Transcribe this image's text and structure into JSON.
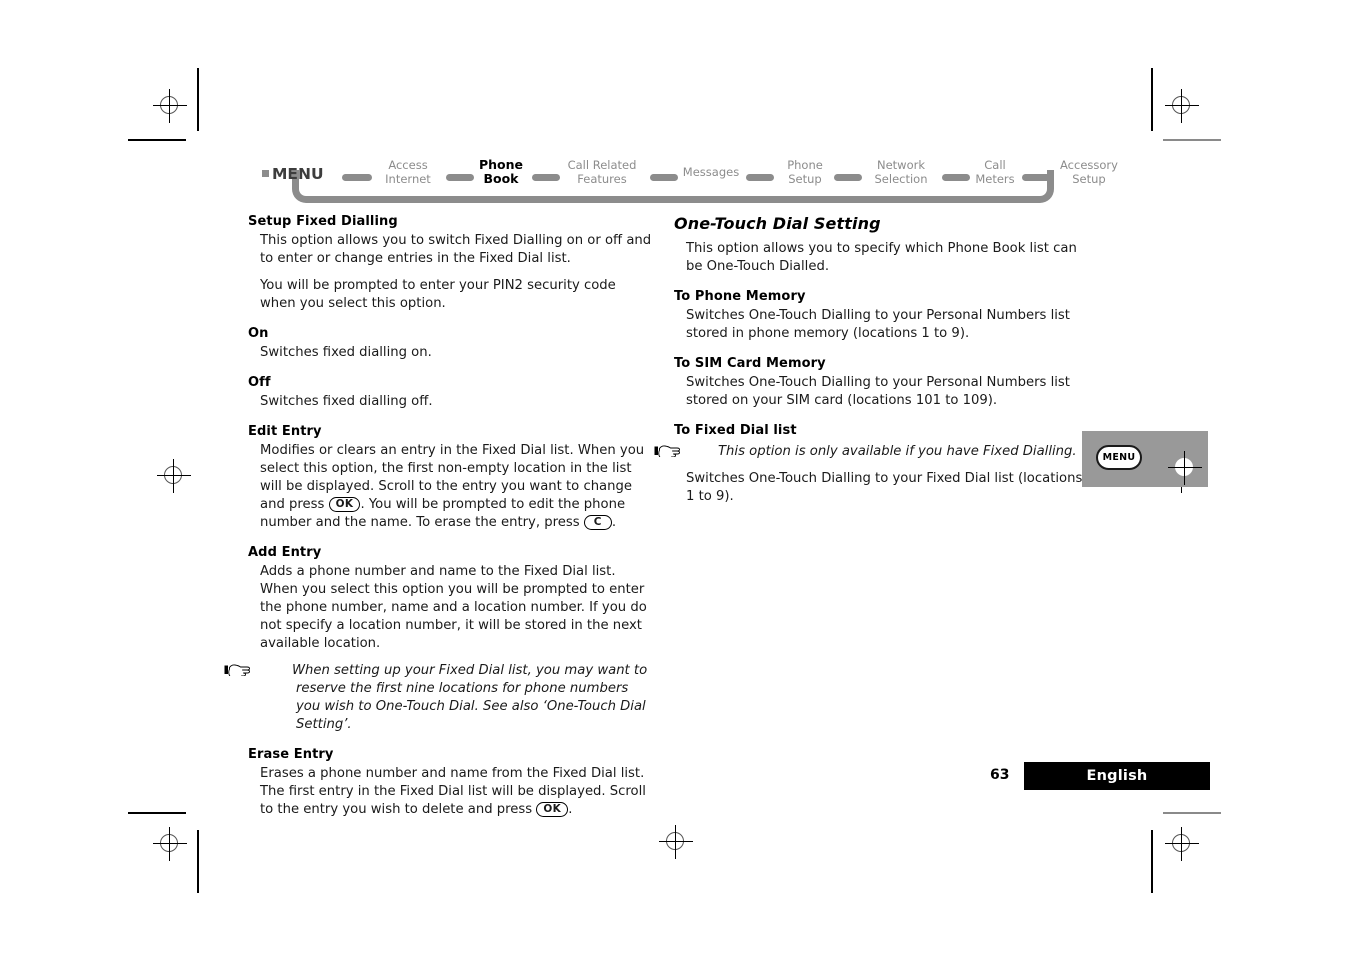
{
  "menu_bar": {
    "label": "MENU",
    "items": [
      {
        "line1": "Access",
        "line2": "Internet",
        "current": false
      },
      {
        "line1": "Phone",
        "line2": "Book",
        "current": true
      },
      {
        "line1": "Call Related",
        "line2": "Features",
        "current": false
      },
      {
        "line1": "Messages",
        "line2": "",
        "current": false
      },
      {
        "line1": "Phone",
        "line2": "Setup",
        "current": false
      },
      {
        "line1": "Network",
        "line2": "Selection",
        "current": false
      },
      {
        "line1": "Call",
        "line2": "Meters",
        "current": false
      },
      {
        "line1": "Accessory",
        "line2": "Setup",
        "current": false
      }
    ]
  },
  "left_column": {
    "heading_setup_fixed_dialling": "Setup Fixed Dialling",
    "setup_para_1": "This option allows you to switch Fixed Dialling on or off and to enter or change entries in the Fixed Dial list.",
    "setup_para_2": "You will be prompted to enter your PIN2 security code when you select this option.",
    "heading_on": "On",
    "on_para": "Switches fixed dialling on.",
    "heading_off": "Off",
    "off_para": "Switches fixed dialling off.",
    "heading_edit_entry": "Edit Entry",
    "edit_para_a": "Modifies or clears an entry in the Fixed Dial list. When you select this option, the first non-empty location in the list will be displayed. Scroll to the entry you want to change and press ",
    "edit_key_ok": "OK",
    "edit_para_b": ". You will be prompted to edit the phone number and the name. To erase the entry, press ",
    "edit_key_c": "C",
    "edit_para_c": ".",
    "heading_add_entry": "Add Entry",
    "add_para": "Adds a phone number and name to the Fixed Dial list. When you select this option you will be prompted to enter the phone number, name and a location number. If you do not specify a location number, it will be stored in the next available location.",
    "add_note": "When setting up your Fixed Dial list, you may want to reserve the first nine locations for phone numbers you wish to One-Touch Dial. See also ‘One-Touch Dial Setting’.",
    "heading_erase_entry": "Erase Entry",
    "erase_para_a": "Erases a phone number and name from the Fixed Dial list. The first entry in the Fixed Dial list will be displayed. Scroll to the entry you wish to delete and press ",
    "erase_key_ok": "OK",
    "erase_para_b": "."
  },
  "right_column": {
    "section_title": "One-Touch Dial Setting",
    "intro_para": "This option allows you to specify which Phone Book list can be One-Touch Dialled.",
    "heading_to_phone_memory": "To Phone Memory",
    "phone_memory_para": "Switches One-Touch Dialling to your Personal Numbers list stored in phone memory (locations 1 to 9).",
    "heading_to_sim_card_memory": "To SIM Card Memory",
    "sim_card_para": "Switches One-Touch Dialling to your Personal Numbers list stored on your SIM card (locations 101 to 109).",
    "heading_to_fixed_dial_list": "To Fixed Dial list",
    "fixed_dial_note": "This option is only available if you have Fixed Dialling.",
    "fixed_dial_para": "Switches One-Touch Dialling to your Fixed Dial list (locations 1 to 9)."
  },
  "illustration": {
    "key_label": "MENU"
  },
  "footer": {
    "page_number": "63",
    "language": "English"
  },
  "colors": {
    "menu_gray": "#8c8c8c",
    "illustration_gray": "#999999",
    "footer_bar": "#000000",
    "body_text": "#1a1a1a"
  }
}
